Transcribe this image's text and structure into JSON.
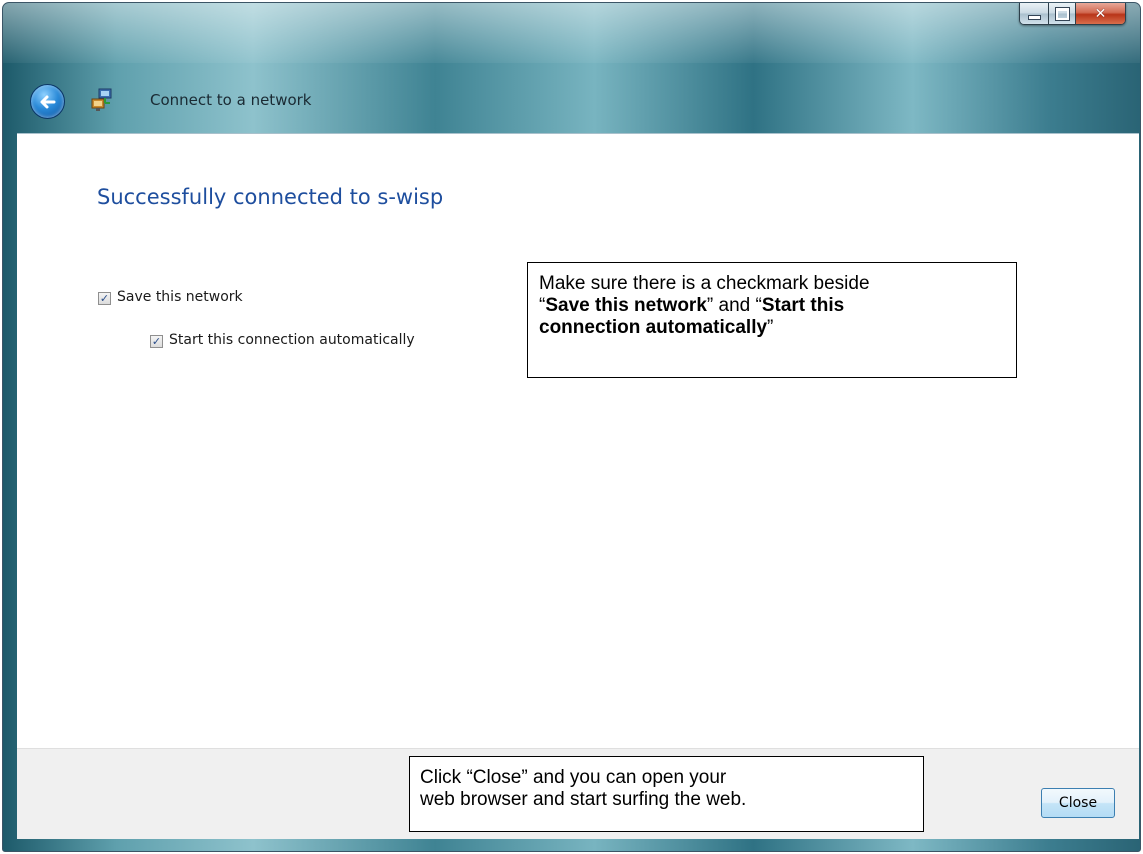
{
  "window": {
    "title": "Connect to a network",
    "caption_buttons": {
      "minimize": "minimize-icon",
      "maximize": "maximize-icon",
      "close": "close-icon"
    }
  },
  "main": {
    "heading": "Successfully connected to s-wisp",
    "options": [
      {
        "label": "Save this network",
        "checked": true
      },
      {
        "label": "Start this connection automatically",
        "checked": true
      }
    ]
  },
  "callouts": {
    "top": {
      "line1": "Make sure there is a checkmark beside",
      "q1": "“",
      "b1": "Save this network",
      "mid": "” and “",
      "b2": "Start this",
      "b3": "connection automatically",
      "q2": "”"
    },
    "bottom": {
      "line1": "Click “Close” and you can open your",
      "line2": "web browser and start surfing the web."
    }
  },
  "footer": {
    "close_label": "Close"
  },
  "colors": {
    "heading": "#1e4e9e",
    "glass": "#3f8393",
    "content": "#ffffff",
    "footer": "#f0f0f0"
  }
}
